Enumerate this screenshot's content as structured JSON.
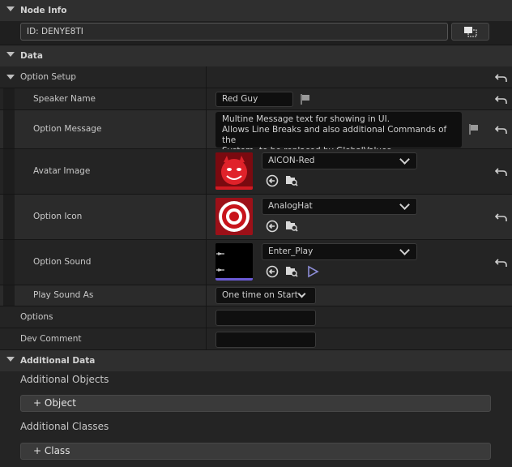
{
  "node_info": {
    "title": "Node Info",
    "id_value": "ID: DENYE8TI"
  },
  "data": {
    "title": "Data",
    "option_setup": {
      "title": "Option Setup",
      "speaker_name": {
        "label": "Speaker Name",
        "value": "Red Guy"
      },
      "option_message": {
        "label": "Option Message",
        "lines": [
          "Multine Message text for showing in UI.",
          "Allows Line Breaks and also additional Commands of the",
          "System, to be replaced by GlobalValues."
        ]
      },
      "avatar_image": {
        "label": "Avatar Image",
        "value": "AICON-Red"
      },
      "option_icon": {
        "label": "Option Icon",
        "value": "AnalogHat"
      },
      "option_sound": {
        "label": "Option Sound",
        "value": "Enter_Play"
      },
      "play_sound_as": {
        "label": "Play Sound As",
        "value": "One time on Start"
      }
    },
    "options": {
      "label": "Options",
      "value": ""
    },
    "dev_comment": {
      "label": "Dev Comment",
      "value": ""
    }
  },
  "additional_data": {
    "title": "Additional Data",
    "objects": {
      "label": "Additional Objects",
      "button": "+ Object"
    },
    "classes": {
      "label": "Additional Classes",
      "button": "+ Class"
    }
  },
  "colors": {
    "panel_bg": "#1a1a1a",
    "category_bg": "#2f2f2f",
    "row_bg": "#242424",
    "field_bg": "#0f0f0f",
    "avatar_red": "#c8141c",
    "sound_bar": "#6b5bd6"
  },
  "icons": [
    "collapse-arrow-icon",
    "reset-arrow-icon",
    "flag-icon",
    "browse-arrow-icon",
    "folder-search-icon",
    "play-icon",
    "copy-select-icon"
  ]
}
